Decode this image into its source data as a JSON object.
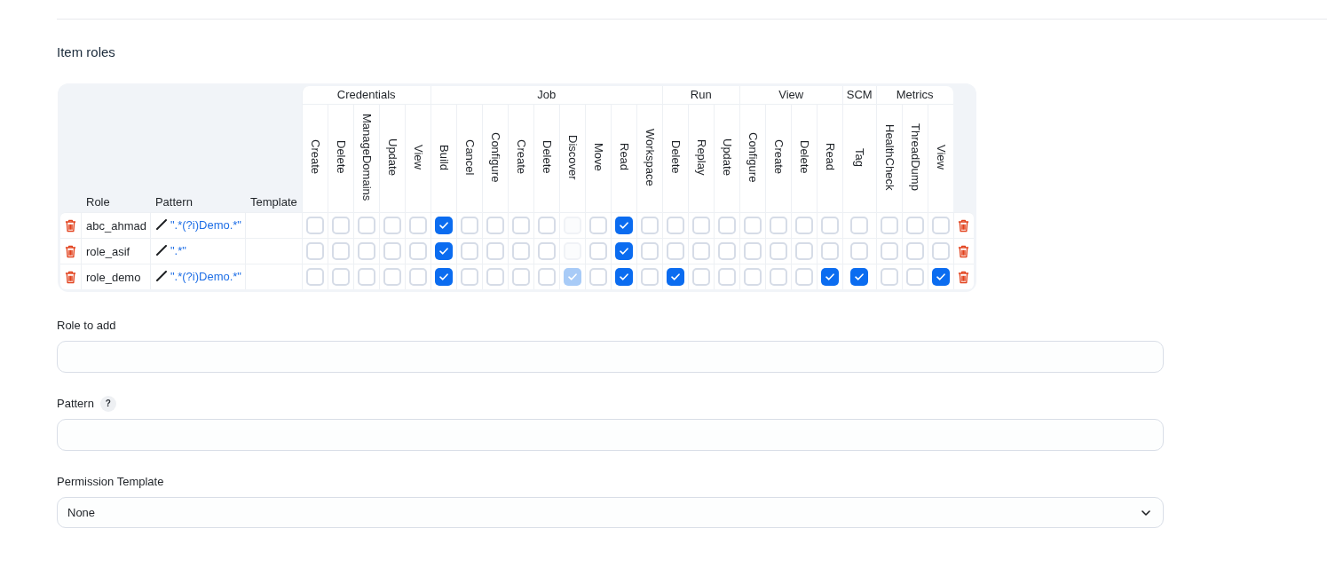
{
  "section_title": "Item roles",
  "table": {
    "columns": [
      "Role",
      "Pattern",
      "Template"
    ],
    "permission_groups": [
      {
        "name": "Credentials",
        "permissions": [
          "Create",
          "Delete",
          "ManageDomains",
          "Update",
          "View"
        ]
      },
      {
        "name": "Job",
        "permissions": [
          "Build",
          "Cancel",
          "Configure",
          "Create",
          "Delete",
          "Discover",
          "Move",
          "Read",
          "Workspace"
        ]
      },
      {
        "name": "Run",
        "permissions": [
          "Delete",
          "Replay",
          "Update"
        ]
      },
      {
        "name": "View",
        "permissions": [
          "Configure",
          "Create",
          "Delete",
          "Read"
        ]
      },
      {
        "name": "SCM",
        "permissions": [
          "Tag"
        ]
      },
      {
        "name": "Metrics",
        "permissions": [
          "HealthCheck",
          "ThreadDump",
          "View"
        ]
      }
    ],
    "rows": [
      {
        "role": "abc_ahmad",
        "pattern": "\".*(?i)Demo.*\"",
        "permissions": [
          {
            "checked": false,
            "disabled": false
          },
          {
            "checked": false,
            "disabled": false
          },
          {
            "checked": false,
            "disabled": false
          },
          {
            "checked": false,
            "disabled": false
          },
          {
            "checked": false,
            "disabled": false
          },
          {
            "checked": true,
            "disabled": false
          },
          {
            "checked": false,
            "disabled": false
          },
          {
            "checked": false,
            "disabled": false
          },
          {
            "checked": false,
            "disabled": false
          },
          {
            "checked": false,
            "disabled": false
          },
          {
            "checked": false,
            "disabled": true
          },
          {
            "checked": false,
            "disabled": false
          },
          {
            "checked": true,
            "disabled": false
          },
          {
            "checked": false,
            "disabled": false
          },
          {
            "checked": false,
            "disabled": false
          },
          {
            "checked": false,
            "disabled": false
          },
          {
            "checked": false,
            "disabled": false
          },
          {
            "checked": false,
            "disabled": false
          },
          {
            "checked": false,
            "disabled": false
          },
          {
            "checked": false,
            "disabled": false
          },
          {
            "checked": false,
            "disabled": false
          },
          {
            "checked": false,
            "disabled": false
          },
          {
            "checked": false,
            "disabled": false
          },
          {
            "checked": false,
            "disabled": false
          },
          {
            "checked": false,
            "disabled": false
          }
        ]
      },
      {
        "role": "role_asif",
        "pattern": "\".*\"",
        "permissions": [
          {
            "checked": false,
            "disabled": false
          },
          {
            "checked": false,
            "disabled": false
          },
          {
            "checked": false,
            "disabled": false
          },
          {
            "checked": false,
            "disabled": false
          },
          {
            "checked": false,
            "disabled": false
          },
          {
            "checked": true,
            "disabled": false
          },
          {
            "checked": false,
            "disabled": false
          },
          {
            "checked": false,
            "disabled": false
          },
          {
            "checked": false,
            "disabled": false
          },
          {
            "checked": false,
            "disabled": false
          },
          {
            "checked": false,
            "disabled": true
          },
          {
            "checked": false,
            "disabled": false
          },
          {
            "checked": true,
            "disabled": false
          },
          {
            "checked": false,
            "disabled": false
          },
          {
            "checked": false,
            "disabled": false
          },
          {
            "checked": false,
            "disabled": false
          },
          {
            "checked": false,
            "disabled": false
          },
          {
            "checked": false,
            "disabled": false
          },
          {
            "checked": false,
            "disabled": false
          },
          {
            "checked": false,
            "disabled": false
          },
          {
            "checked": false,
            "disabled": false
          },
          {
            "checked": false,
            "disabled": false
          },
          {
            "checked": false,
            "disabled": false
          },
          {
            "checked": false,
            "disabled": false
          },
          {
            "checked": false,
            "disabled": false
          }
        ]
      },
      {
        "role": "role_demo",
        "pattern": "\".*(?i)Demo.*\"",
        "permissions": [
          {
            "checked": false,
            "disabled": false
          },
          {
            "checked": false,
            "disabled": false
          },
          {
            "checked": false,
            "disabled": false
          },
          {
            "checked": false,
            "disabled": false
          },
          {
            "checked": false,
            "disabled": false
          },
          {
            "checked": true,
            "disabled": false
          },
          {
            "checked": false,
            "disabled": false
          },
          {
            "checked": false,
            "disabled": false
          },
          {
            "checked": false,
            "disabled": false
          },
          {
            "checked": false,
            "disabled": false
          },
          {
            "checked": true,
            "disabled": true
          },
          {
            "checked": false,
            "disabled": false
          },
          {
            "checked": true,
            "disabled": false
          },
          {
            "checked": false,
            "disabled": false
          },
          {
            "checked": true,
            "disabled": false
          },
          {
            "checked": false,
            "disabled": false
          },
          {
            "checked": false,
            "disabled": false
          },
          {
            "checked": false,
            "disabled": false
          },
          {
            "checked": false,
            "disabled": false
          },
          {
            "checked": false,
            "disabled": false
          },
          {
            "checked": true,
            "disabled": false
          },
          {
            "checked": true,
            "disabled": false
          },
          {
            "checked": false,
            "disabled": false
          },
          {
            "checked": false,
            "disabled": false
          },
          {
            "checked": true,
            "disabled": false
          }
        ]
      }
    ]
  },
  "form": {
    "fields": [
      {
        "label": "Role to add",
        "kind": "text"
      },
      {
        "label": "Pattern",
        "kind": "text",
        "help": "?"
      },
      {
        "label": "Permission Template",
        "kind": "select",
        "value": "None"
      }
    ]
  }
}
